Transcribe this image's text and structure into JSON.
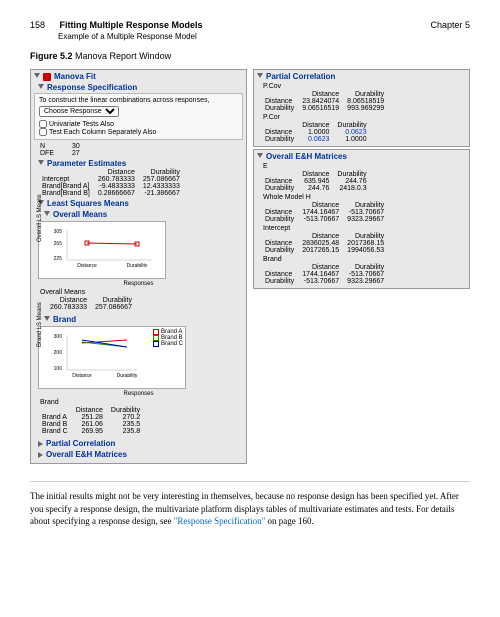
{
  "header": {
    "page": "158",
    "title": "Fitting Multiple Response Models",
    "subtitle": "Example of a Multiple Response Model",
    "chapter": "Chapter 5"
  },
  "figure_caption_bold": "Figure 5.2",
  "figure_caption": "Manova Report Window",
  "left": {
    "fit": "Manova Fit",
    "respspec": {
      "title": "Response Specification",
      "instr": "To construct the linear combinations across responses,",
      "dropdown": "Choose Response",
      "cb1": "Univariate Tests Also",
      "cb2": "Test Each Column Separately Also",
      "n_lbl": "N",
      "n_val": "30",
      "dfe_lbl": "DFE",
      "dfe_val": "27"
    },
    "param": {
      "title": "Parameter Estimates",
      "cols": [
        "",
        "Distance",
        "Durability"
      ],
      "rows": [
        [
          "Intercept",
          "260.783333",
          "257.086667"
        ],
        [
          "Brand[Brand A]",
          "-9.4833333",
          "12.4333333"
        ],
        [
          "Brand[Brand B]",
          "0.28666667",
          "-21.386667"
        ]
      ]
    },
    "lsm": {
      "title": "Least Squares Means",
      "overall": {
        "title": "Overall Means",
        "label": "Overall Means",
        "cols": [
          "",
          "Distance",
          "Durability"
        ],
        "row": [
          "",
          "260.783333",
          "257.086667"
        ]
      },
      "brand": {
        "title": "Brand",
        "label": "Brand",
        "cols": [
          "",
          "Distance",
          "Durability"
        ],
        "rows": [
          [
            "Brand A",
            "251.28",
            "270.2"
          ],
          [
            "Brand B",
            "261.06",
            "235.5"
          ],
          [
            "Brand C",
            "269.95",
            "235.8"
          ]
        ],
        "legend": [
          "Brand A",
          "Brand B",
          "Brand C"
        ]
      },
      "xlabels": [
        "Distance",
        "Durability"
      ],
      "xaxis": "Responses"
    },
    "partial": "Partial Correlation",
    "eh": "Overall E&H Matrices"
  },
  "right": {
    "partial": {
      "title": "Partial Correlation",
      "pcov_lbl": "P.Cov",
      "cols": [
        "",
        "Distance",
        "Durability"
      ],
      "pcov_rows": [
        [
          "Distance",
          "23.8424074",
          "8.06518519"
        ],
        [
          "Durability",
          "9.06516519",
          "993.969299"
        ]
      ],
      "pcor_lbl": "P.Cor",
      "pcor_rows": [
        [
          "Distance",
          "1.0000",
          "0.0623"
        ],
        [
          "Durability",
          "0.0623",
          "1.0000"
        ]
      ]
    },
    "eh": {
      "title": "Overall E&H Matrices",
      "e_lbl": "E",
      "cols": [
        "",
        "Distance",
        "Durability"
      ],
      "e_rows": [
        [
          "Distance",
          "635.945",
          "244.76"
        ],
        [
          "Durability",
          "244.76",
          "2418.0.3"
        ]
      ],
      "whole_lbl": "Whole Model H",
      "whole_rows": [
        [
          "Distance",
          "1744.16467",
          "-513.70667"
        ],
        [
          "Durability",
          "-513.70667",
          "9323.29667"
        ]
      ],
      "intercept_lbl": "Intercept",
      "intercept_rows": [
        [
          "Distance",
          "2836025.48",
          "2017368.15"
        ],
        [
          "Durability",
          "2017265.15",
          "1994056.53"
        ]
      ],
      "brand_lbl": "Brand",
      "brand_rows": [
        [
          "Distance",
          "1744.16467",
          "-513.70667"
        ],
        [
          "Durability",
          "-513.70667",
          "9323.29667"
        ]
      ]
    }
  },
  "body": "The initial results might not be very interesting in themselves, because no response design has been specified yet. After you specify a response design, the multivariate platform displays tables of multivariate estimates and tests. For details about specifying a response design, see ",
  "link": "\"Response Specification\"",
  "body_tail": " on page 160.",
  "chart_data": [
    {
      "type": "line",
      "title": "Overall Means",
      "categories": [
        "Distance",
        "Durability"
      ],
      "series": [
        {
          "name": "Overall",
          "values": [
            260.78,
            257.09
          ]
        }
      ],
      "ylim": [
        225,
        305
      ]
    },
    {
      "type": "line",
      "title": "Brand",
      "categories": [
        "Distance",
        "Durability"
      ],
      "series": [
        {
          "name": "Brand A",
          "values": [
            251.28,
            270.2
          ]
        },
        {
          "name": "Brand B",
          "values": [
            261.06,
            235.5
          ]
        },
        {
          "name": "Brand C",
          "values": [
            269.95,
            235.8
          ]
        }
      ],
      "ylim": [
        100,
        300
      ]
    }
  ]
}
